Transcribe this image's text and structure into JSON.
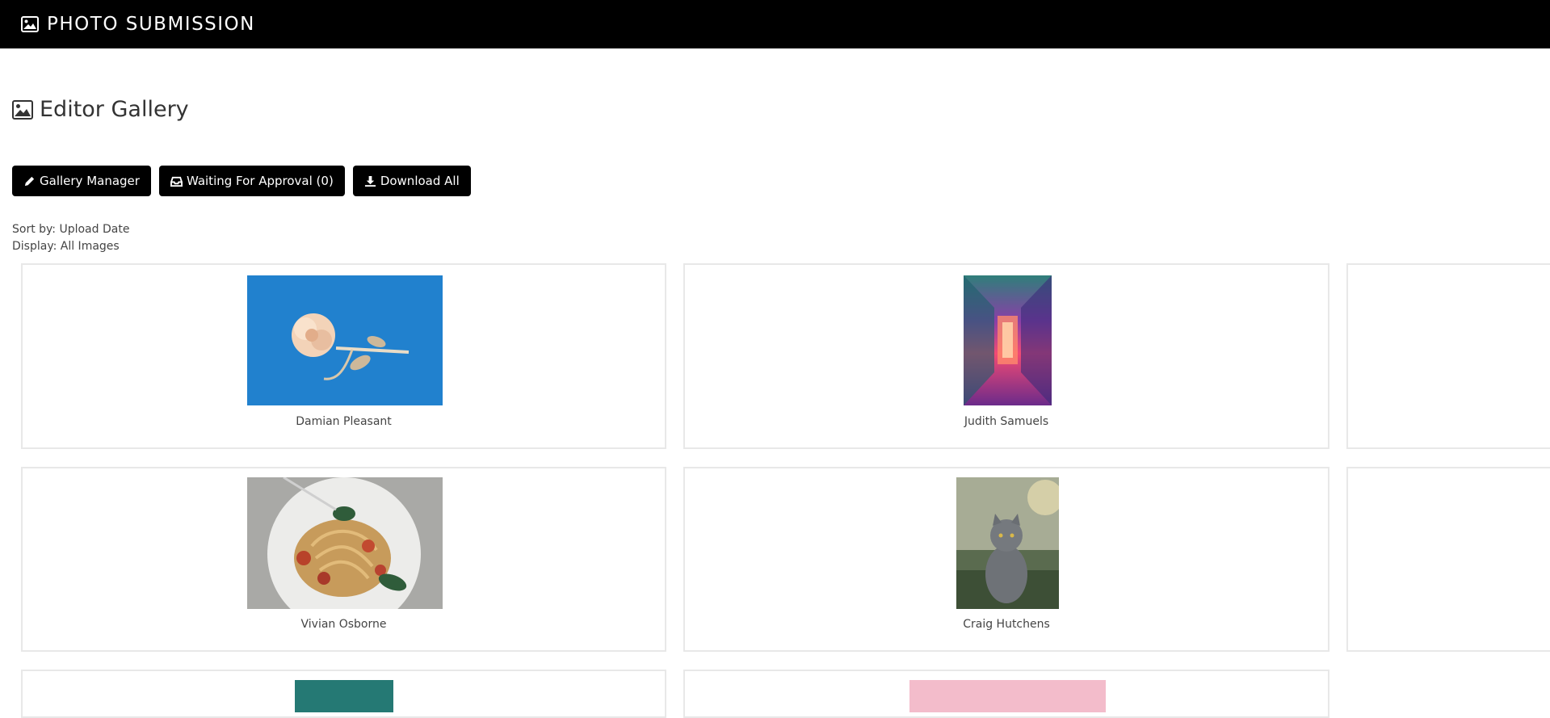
{
  "app": {
    "title": "PHOTO SUBMISSION",
    "icon": "image-icon"
  },
  "page": {
    "title": "Editor Gallery",
    "icon": "image-icon"
  },
  "toolbar": {
    "gallery_manager": "Gallery Manager",
    "waiting_for_approval": "Waiting For Approval (0)",
    "download_all": "Download All"
  },
  "filters": {
    "sort_by": "Sort by: Upload Date",
    "display": "Display: All Images"
  },
  "gallery": {
    "items": [
      {
        "name": "Damian Pleasant",
        "image": "rose on blue background"
      },
      {
        "name": "Judith Samuels",
        "image": "neon corridor"
      },
      {
        "name": "Vivian Osborne",
        "image": "spaghetti with tomatoes"
      },
      {
        "name": "Craig Hutchens",
        "image": "grey cat sitting on grass"
      },
      {
        "name": "",
        "image": "teal texture"
      },
      {
        "name": "",
        "image": "pink background"
      }
    ]
  },
  "colors": {
    "topbar": "#000000",
    "button": "#000000",
    "card_border": "#e8e8e8"
  }
}
